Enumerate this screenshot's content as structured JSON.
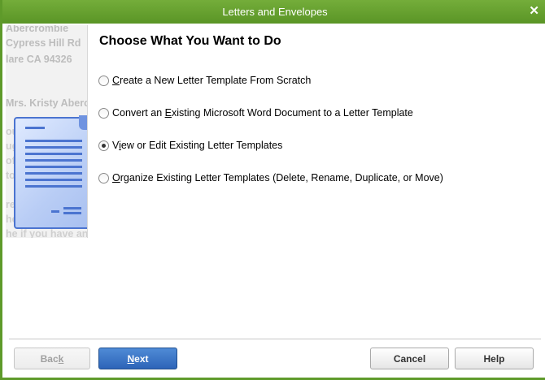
{
  "window": {
    "title": "Letters and Envelopes",
    "close_glyph": "✕"
  },
  "illustration": {
    "lines": [
      "Abercrombie",
      "Cypress Hill Rd",
      "lare CA 94326",
      "Mrs. Kristy Aberc"
    ],
    "faded": [
      "ou",
      "ugs",
      "offi",
      "to",
      "re",
      "he",
      "he if you have an"
    ]
  },
  "heading": "Choose What You Want to Do",
  "options": [
    {
      "pre": "",
      "u": "C",
      "post": "reate a New Letter Template From Scratch",
      "checked": false
    },
    {
      "pre": "Convert an ",
      "u": "E",
      "post": "xisting Microsoft Word Document to a Letter Template",
      "checked": false
    },
    {
      "pre": "V",
      "u": "i",
      "post": "ew or Edit Existing Letter Templates",
      "checked": true
    },
    {
      "pre": "",
      "u": "O",
      "post": "rganize Existing Letter Templates (Delete, Rename, Duplicate, or Move)",
      "checked": false
    }
  ],
  "buttons": {
    "back": {
      "pre": "Bac",
      "u": "k"
    },
    "next": {
      "u": "N",
      "post": "ext"
    },
    "cancel": "Cancel",
    "help": "Help"
  }
}
